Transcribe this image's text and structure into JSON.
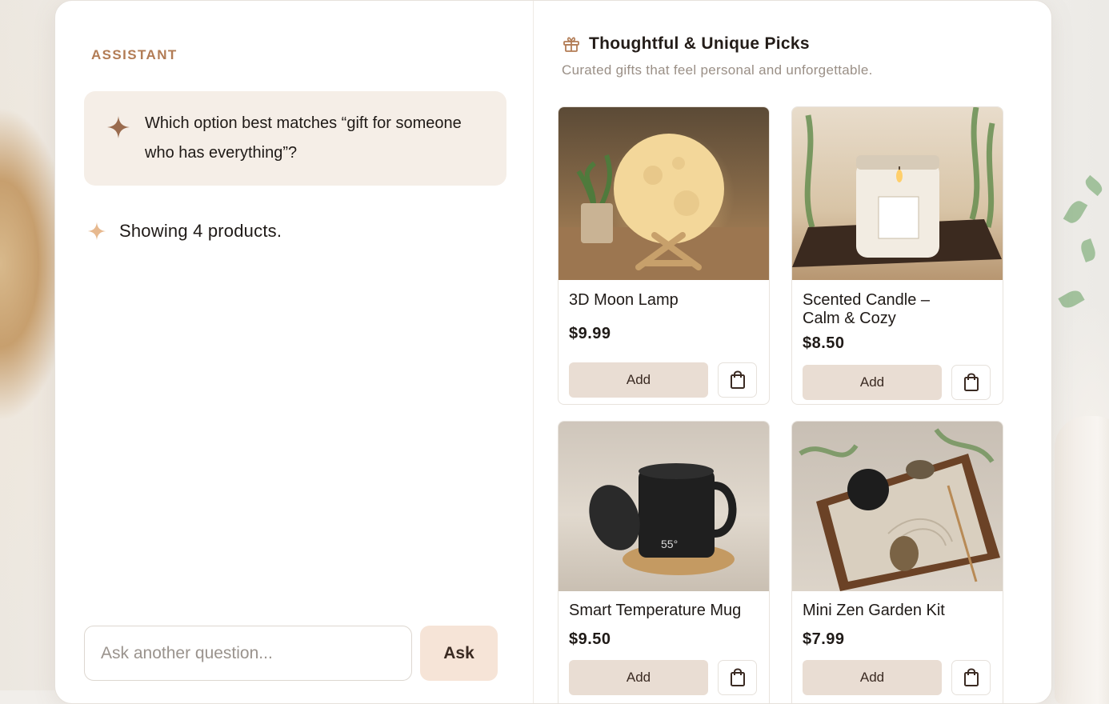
{
  "assistant": {
    "role_label": "ASSISTANT",
    "question": "Which option best matches “gift for someone who has everything”?",
    "status": "Showing 4 products."
  },
  "composer": {
    "placeholder": "Ask another question...",
    "ask_label": "Ask"
  },
  "catalog": {
    "title": "Thoughtful & Unique Picks",
    "subtitle": "Curated gifts that feel personal and unforgettable.",
    "products": [
      {
        "name": "3D Moon Lamp",
        "price": "$9.99",
        "add_label": "Add"
      },
      {
        "name": "Scented Candle – Calm & Cozy",
        "price": "$8.50",
        "add_label": "Add"
      },
      {
        "name": "Smart Temperature Mug",
        "price": "$9.50",
        "add_label": "Add"
      },
      {
        "name": "Mini Zen Garden Kit",
        "price": "$7.99",
        "add_label": "Add"
      }
    ]
  },
  "colors": {
    "accent": "#b27c55",
    "bubble": "#f5eee7",
    "ask_button": "#f6e4d7",
    "add_button": "#e9ddd3"
  },
  "icons": {
    "sparkle": "sparkle-icon",
    "gift": "gift-icon",
    "bag": "shopping-bag-icon"
  }
}
